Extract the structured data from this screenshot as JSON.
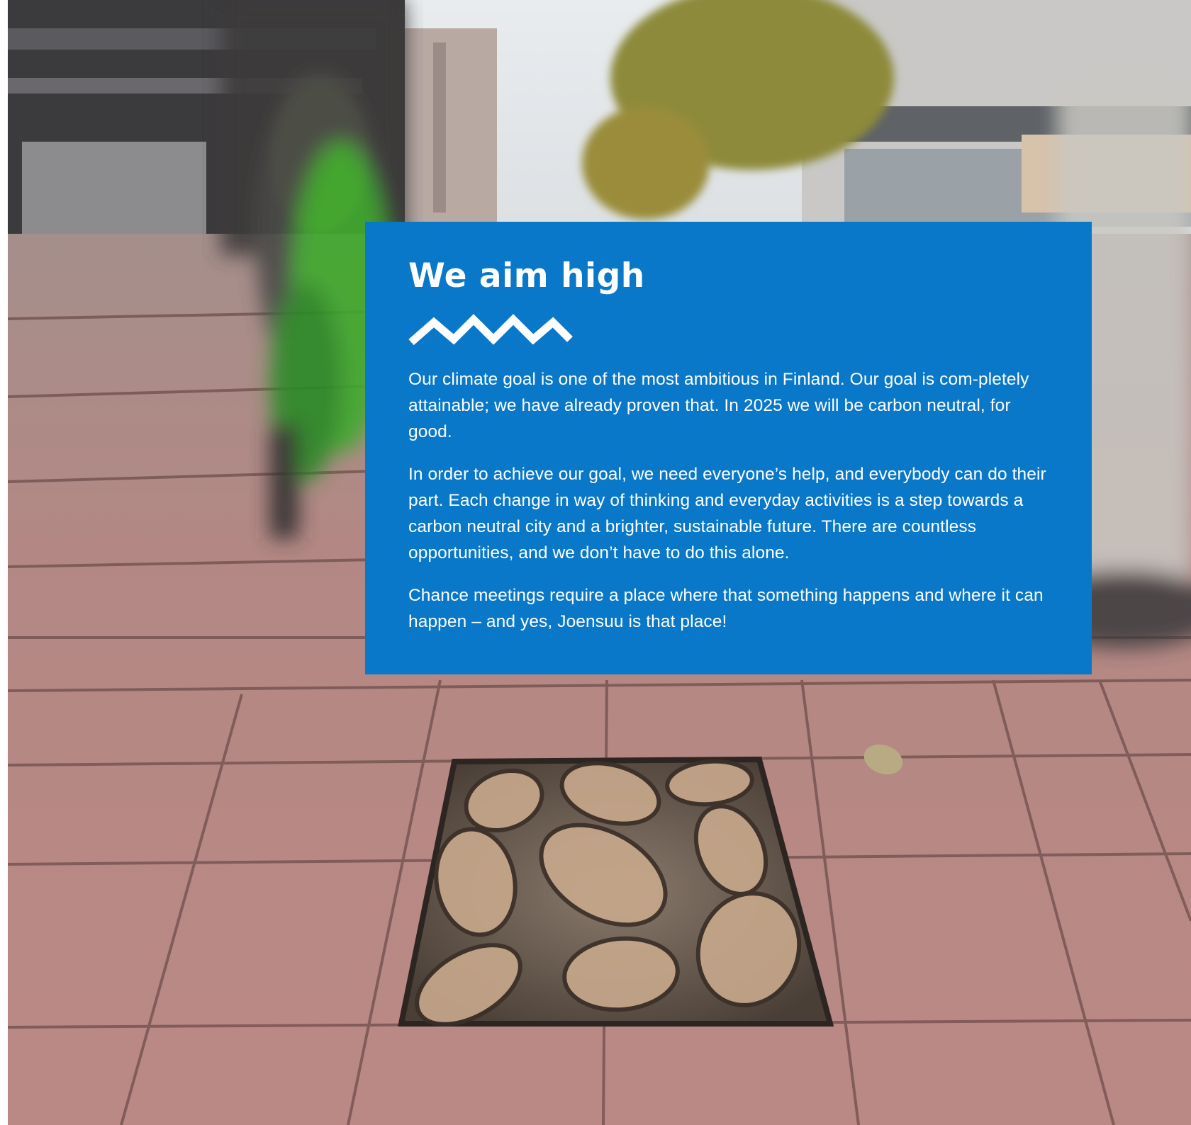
{
  "card": {
    "title": "We aim high",
    "paragraphs": [
      "Our climate goal is one of the most ambitious in Finland. Our goal is com-pletely attainable; we have already proven that. In 2025 we will be carbon neutral, for good.",
      "In order to achieve our goal, we need everyone’s help, and everybody can do their part. Each change in way of thinking and everyday activities is a step towards a carbon neutral city and a brighter, sustainable future. There are countless opportunities, and we don’t have to do this alone.",
      "Chance meetings require a place where that something happens and where it can happen – and yes, Joensuu is that place!"
    ],
    "background_color": "#0a78c8",
    "text_color": "#ffffff"
  },
  "photo": {
    "subject": "street-pavement-with-bronze-leaf-tile-and-cyclist",
    "pavement_color": "#b98a86"
  },
  "icons": {
    "wave": "zigzag-wave-icon"
  }
}
